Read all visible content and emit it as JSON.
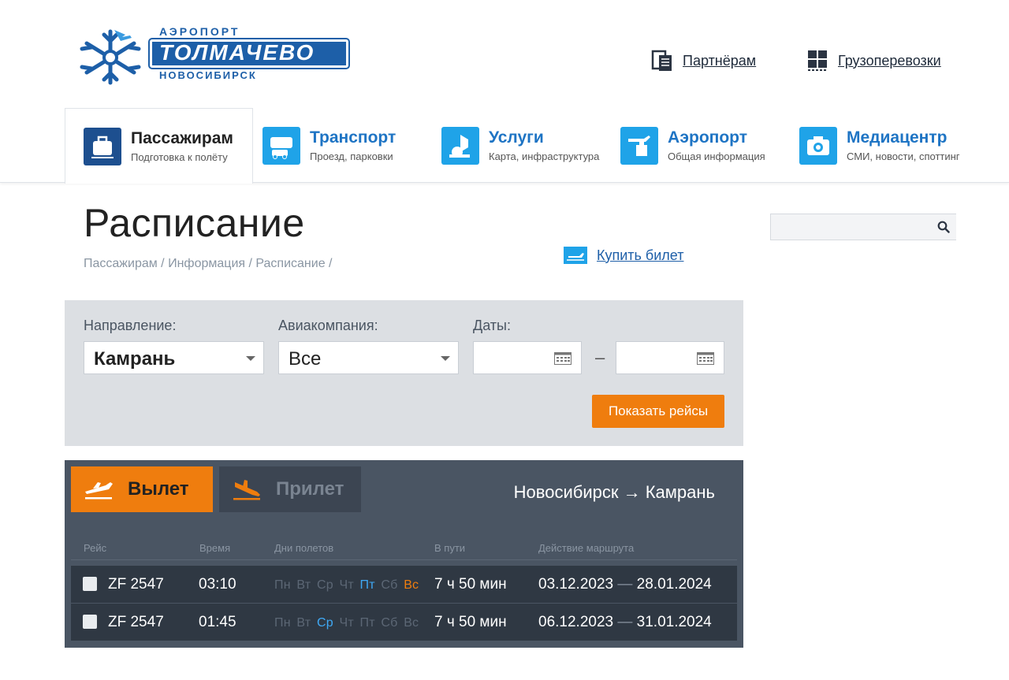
{
  "header": {
    "logo": {
      "top": "АЭРОПОРТ",
      "main": "ТОЛМАЧЕВО",
      "sub": "НОВОСИБИРСК"
    },
    "links": [
      {
        "label": "Партнёрам",
        "icon": "partners-icon"
      },
      {
        "label": "Грузоперевозки",
        "icon": "cargo-icon"
      }
    ]
  },
  "nav": [
    {
      "title": "Пассажирам",
      "subtitle": "Подготовка к полёту",
      "icon": "suitcase-icon",
      "active": true
    },
    {
      "title": "Транспорт",
      "subtitle": "Проезд, парковки",
      "icon": "transport-icon",
      "active": false
    },
    {
      "title": "Услуги",
      "subtitle": "Карта, инфраструктура",
      "icon": "services-icon",
      "active": false
    },
    {
      "title": "Аэропорт",
      "subtitle": "Общая информация",
      "icon": "airport-icon",
      "active": false
    },
    {
      "title": "Медиацентр",
      "subtitle": "СМИ, новости, споттинг",
      "icon": "camera-icon",
      "active": false
    }
  ],
  "page": {
    "title": "Расписание",
    "breadcrumb": [
      "Пассажирам",
      "Информация",
      "Расписание"
    ],
    "buy_ticket": "Купить билет",
    "search_placeholder": ""
  },
  "filter": {
    "direction_label": "Направление:",
    "direction_value": "Камрань",
    "airline_label": "Авиакомпания:",
    "airline_value": "Все",
    "dates_label": "Даты:",
    "date_from": "",
    "date_to": "",
    "dash": "–",
    "submit": "Показать рейсы"
  },
  "flights": {
    "departure_tab": "Вылет",
    "arrival_tab": "Прилет",
    "route": "Новосибирск → Камрань",
    "columns": [
      "Рейс",
      "Время",
      "Дни полетов",
      "В пути",
      "Действие маршрута"
    ],
    "weekdays": [
      "Пн",
      "Вт",
      "Ср",
      "Чт",
      "Пт",
      "Сб",
      "Вс"
    ],
    "rows": [
      {
        "flight": "ZF 2547",
        "time": "03:10",
        "days_active": [
          "Пт",
          "Вс"
        ],
        "duration": "7 ч 50 мин",
        "from": "03.12.2023",
        "to": "28.01.2024"
      },
      {
        "flight": "ZF 2547",
        "time": "01:45",
        "days_active": [
          "Ср"
        ],
        "duration": "7 ч 50 мин",
        "from": "06.12.2023",
        "to": "31.01.2024"
      }
    ],
    "range_sep": "—"
  },
  "colors": {
    "brand_blue": "#1d5fa8",
    "nav_icon_blue": "#1fa3e8",
    "accent_orange": "#ef7d0e",
    "panel_dark": "#4a5563",
    "row_dark": "#2f3843",
    "day_active_blue": "#3fa9f5"
  }
}
